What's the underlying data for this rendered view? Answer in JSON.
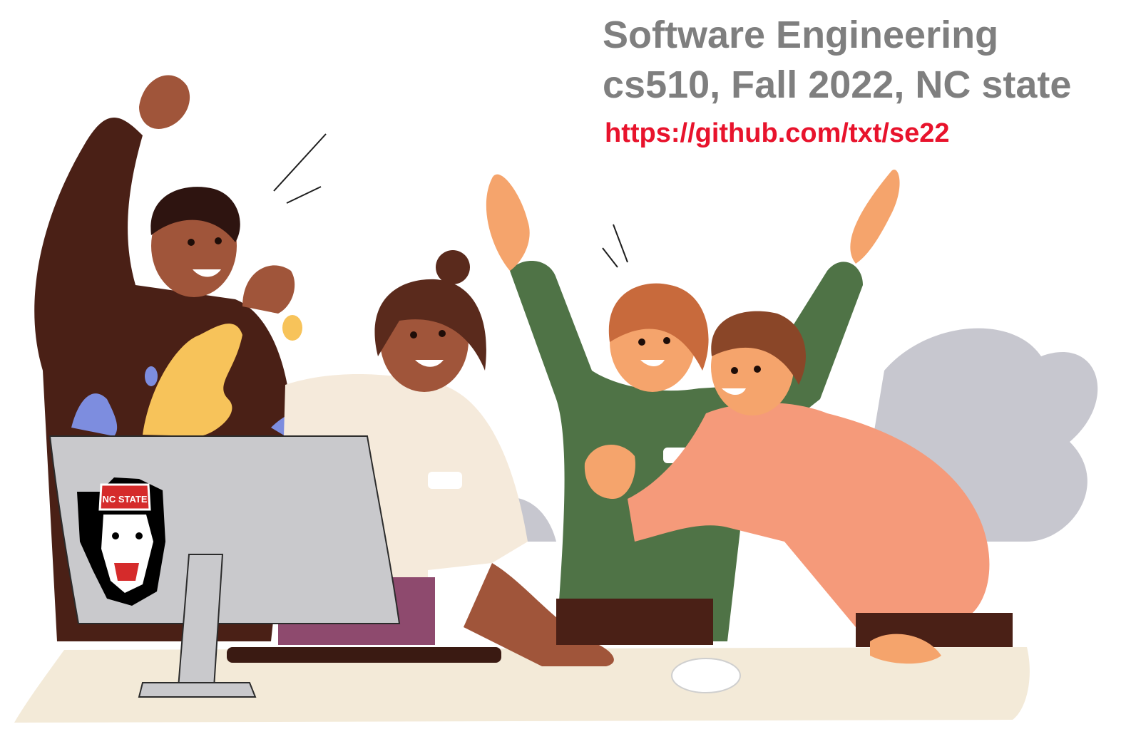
{
  "header": {
    "title": "Software Engineering",
    "subtitle": "cs510, Fall 2022, NC state",
    "link": "https://github.com/txt/se22"
  },
  "illustration": {
    "logo_text": "NC STATE",
    "colors": {
      "title_gray": "#7f7f7f",
      "link_red": "#e8132c",
      "dark_brown": "#4a2016",
      "skin_brown": "#a0553a",
      "cream_shirt": "#f5eadb",
      "green_sweater": "#4f7346",
      "salmon_sweater": "#f59a7a",
      "monitor_gray": "#c9c9cc",
      "desk_cream": "#f3ead8",
      "plant_gray": "#c7c7cf",
      "splash_yellow": "#f7c35a",
      "splash_blue": "#7d8ddf"
    }
  }
}
